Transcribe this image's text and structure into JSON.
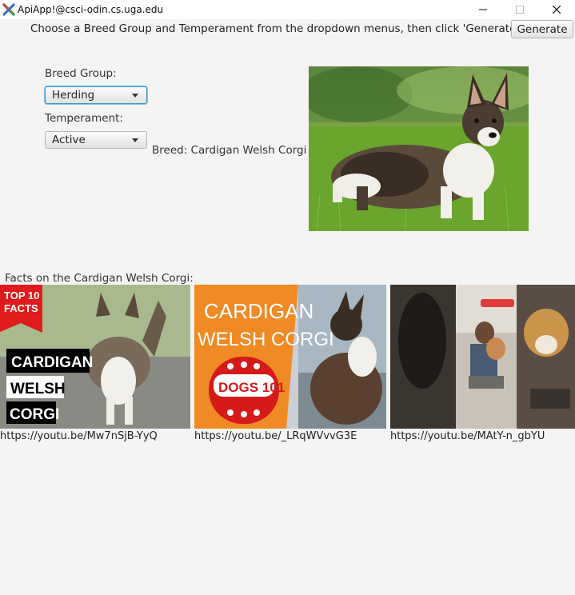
{
  "window": {
    "title": "ApiApp!@csci-odin.cs.uga.edu",
    "app_icon": "x-app-icon",
    "minimize_icon": "minimize-icon",
    "maximize_icon": "maximize-icon",
    "close_icon": "close-icon"
  },
  "toolbar": {
    "instruction": "Choose a Breed Group and Temperament from the dropdown menus, then click 'Generate'.",
    "generate_label": "Generate"
  },
  "form": {
    "breed_group_label": "Breed Group:",
    "breed_group_value": "Herding",
    "temperament_label": "Temperament:",
    "temperament_value": "Active",
    "breed_text": "Breed: Cardigan Welsh Corgi"
  },
  "facts": {
    "heading": "Facts on the Cardigan Welsh Corgi:",
    "videos": [
      {
        "url": "https://youtu.be/Mw7nSjB-YyQ",
        "badge": "TOP 10\nFACTS",
        "lines": [
          "CARDIGAN",
          "WELSH",
          "CORGI"
        ]
      },
      {
        "url": "https://youtu.be/_LRqWVvvG3E",
        "title_lines": [
          "CARDIGAN",
          "WELSH CORGI"
        ],
        "badge": "DOGS 101"
      },
      {
        "url": "https://youtu.be/MAtY-n_gbYU"
      }
    ]
  }
}
